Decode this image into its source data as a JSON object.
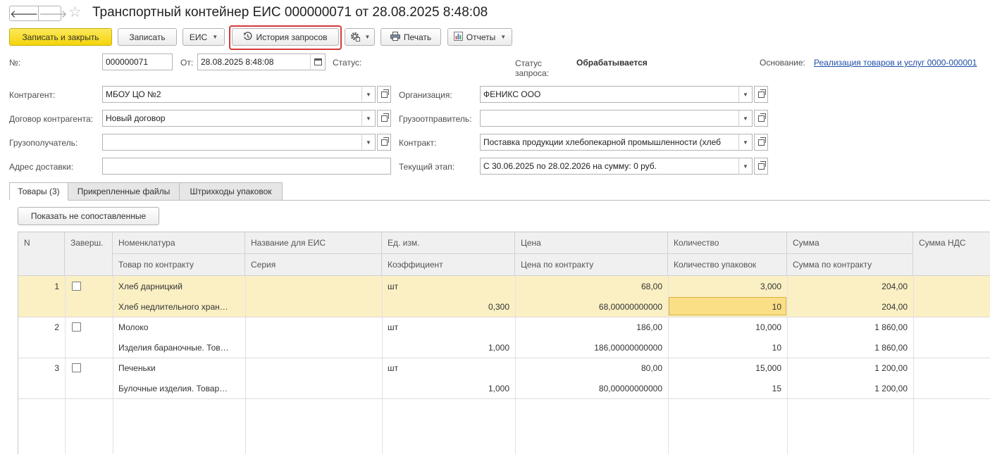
{
  "window": {
    "title": "Транспортный контейнер ЕИС 000000071 от 28.08.2025 8:48:08",
    "back_glyph": "🡐",
    "forward_glyph": "🡒",
    "favorite_glyph": "☆"
  },
  "toolbar": {
    "save_close": "Записать и закрыть",
    "save": "Записать",
    "eis": "ЕИС",
    "history": "История запросов",
    "print": "Печать",
    "reports": "Отчеты",
    "icons": {
      "history": "history-clock-icon",
      "settings": "gear-icon",
      "print": "printer-icon",
      "reports": "chart-icon"
    },
    "colors": {
      "primary": "#f6d916",
      "highlight_frame": "#d53a3a"
    }
  },
  "header": {
    "number_label": "№:",
    "number_value": "000000071",
    "from_label": "От:",
    "date_value": "28.08.2025  8:48:08",
    "status_label": "Статус:",
    "request_status_label_1": "Статус",
    "request_status_label_2": "запроса:",
    "request_status_value": "Обрабатывается",
    "basis_label": "Основание:",
    "basis_value": "Реализация товаров и услуг 0000-000001"
  },
  "form": {
    "counterparty_label": "Контрагент:",
    "counterparty_value": "МБОУ ЦО №2",
    "contract_cp_label": "Договор контрагента:",
    "contract_cp_value": "Новый договор",
    "consignee_label": "Грузополучатель:",
    "consignee_value": "",
    "delivery_label": "Адрес доставки:",
    "delivery_value": "",
    "org_label": "Организация:",
    "org_value": "ФЕНИКС ООО",
    "shipper_label": "Грузоотправитель:",
    "shipper_value": "",
    "contract_label": "Контракт:",
    "contract_value": "Поставка продукции хлебопекарной промышленности (хлеб",
    "stage_label": "Текущий этап:",
    "stage_value": "С 30.06.2025 по 28.02.2026 на сумму: 0 руб."
  },
  "tabs": {
    "goods": "Товары (3)",
    "files": "Прикрепленные файлы",
    "barcodes": "Штрихкоды упаковок"
  },
  "goods": {
    "show_unmatched": "Показать не сопоставленные",
    "headers": {
      "n": "N",
      "done": "Заверш.",
      "nomenclature": "Номенклатура",
      "contract_item": "Товар по контракту",
      "eis_name": "Название для ЕИС",
      "series": "Серия",
      "unit": "Ед. изм.",
      "coef": "Коэффициент",
      "price": "Цена",
      "contract_price": "Цена по контракту",
      "qty": "Количество",
      "pack_qty": "Количество упаковок",
      "sum": "Сумма",
      "contract_sum": "Сумма по контракту",
      "vat": "Сумма НДС"
    },
    "rows": [
      {
        "n": "1",
        "nomenclature": "Хлеб дарницкий",
        "contract_item": "Хлеб недлительного хран…",
        "eis_name": "",
        "series": "",
        "unit": "шт",
        "coef": "0,300",
        "price": "68,00",
        "contract_price": "68,00000000000",
        "qty": "3,000",
        "pack_qty": "10",
        "sum": "204,00",
        "contract_sum": "204,00"
      },
      {
        "n": "2",
        "nomenclature": "Молоко",
        "contract_item": "Изделия бараночные. Тов…",
        "eis_name": "",
        "series": "",
        "unit": "шт",
        "coef": "1,000",
        "price": "186,00",
        "contract_price": "186,00000000000",
        "qty": "10,000",
        "pack_qty": "10",
        "sum": "1 860,00",
        "contract_sum": "1 860,00"
      },
      {
        "n": "3",
        "nomenclature": "Печеньки",
        "contract_item": "Булочные изделия. Товар…",
        "eis_name": "",
        "series": "",
        "unit": "шт",
        "coef": "1,000",
        "price": "80,00",
        "contract_price": "80,00000000000",
        "qty": "15,000",
        "pack_qty": "15",
        "sum": "1 200,00",
        "contract_sum": "1 200,00"
      }
    ],
    "colors": {
      "selected_row": "#fbf0c4",
      "current_cell": "#fbdf87"
    }
  }
}
